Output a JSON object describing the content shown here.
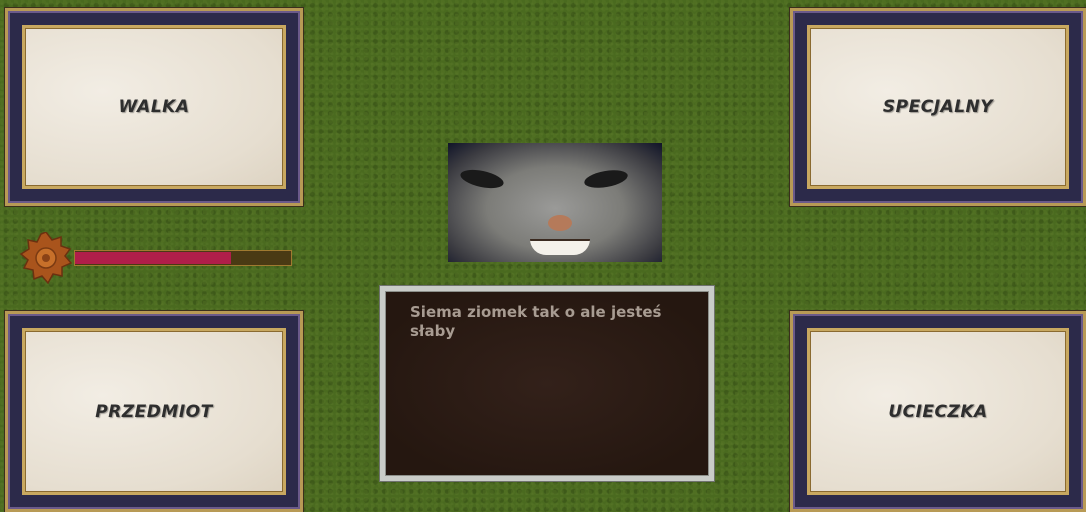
{
  "buttons": {
    "fight": "WALKA",
    "special": "SPECJALNY",
    "item": "PRZEDMIOT",
    "flee": "UCIECZKA"
  },
  "dialog": {
    "message": "Siema ziomek tak o ale jesteś słaby"
  },
  "health": {
    "fraction": 0.72,
    "color": "#b01e4a"
  },
  "icons": {
    "gear": "gear-icon",
    "portrait": "enemy-portrait"
  }
}
